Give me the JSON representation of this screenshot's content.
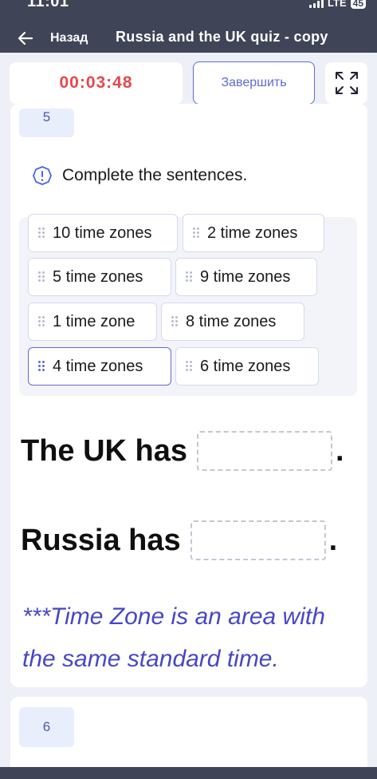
{
  "status_bar": {
    "time": "11:01",
    "network": "LTE",
    "battery": "45"
  },
  "nav": {
    "back_label": "Назад",
    "title": "Russia and the UK quiz - copy"
  },
  "controls": {
    "timer": "00:03:48",
    "finish_label": "Завершить"
  },
  "question": {
    "number": "5",
    "instruction": "Complete the sentences.",
    "word_bank": [
      "10 time zones",
      "2 time zones",
      "5 time zones",
      "9 time zones",
      "1 time zone",
      "8 time zones",
      "4 time zones",
      "6 time zones"
    ],
    "selected_option": "4 time zones",
    "sentences": [
      {
        "text": "The UK has",
        "end": "."
      },
      {
        "text": "Russia has",
        "end": "."
      }
    ],
    "note_lines": [
      "***Time Zone is an area with",
      "the same standard time."
    ]
  },
  "next_question": {
    "number": "6"
  },
  "colors": {
    "accent": "#5e6ad2",
    "timer": "#e5484d",
    "note": "#4747c6",
    "header": "#3f4457"
  }
}
